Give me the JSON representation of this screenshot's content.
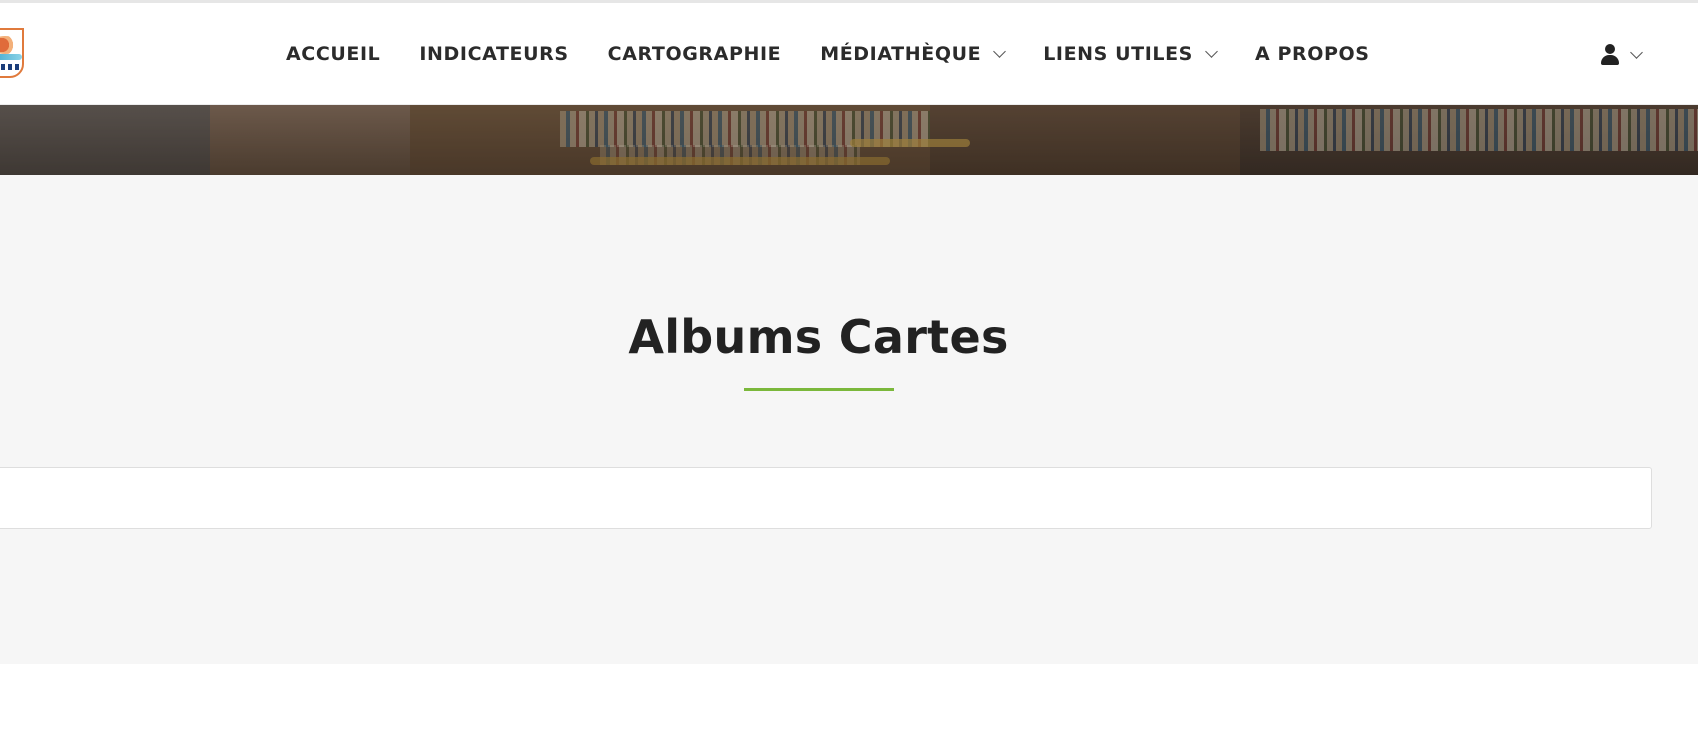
{
  "nav": {
    "items": [
      {
        "label": "ACCUEIL",
        "has_dropdown": false
      },
      {
        "label": "INDICATEURS",
        "has_dropdown": false
      },
      {
        "label": "CARTOGRAPHIE",
        "has_dropdown": false
      },
      {
        "label": "MÉDIATHÈQUE",
        "has_dropdown": true
      },
      {
        "label": "LIENS UTILES",
        "has_dropdown": true
      },
      {
        "label": "A PROPOS",
        "has_dropdown": false
      }
    ],
    "user_menu_icon": "user-icon",
    "dropdown_icon": "chevron-down-icon"
  },
  "main": {
    "title": "Albums Cartes",
    "accent_color": "#7bb83b"
  },
  "colors": {
    "nav_text": "#2b2b2b",
    "content_background": "#f6f6f6",
    "title_text": "#222222"
  }
}
